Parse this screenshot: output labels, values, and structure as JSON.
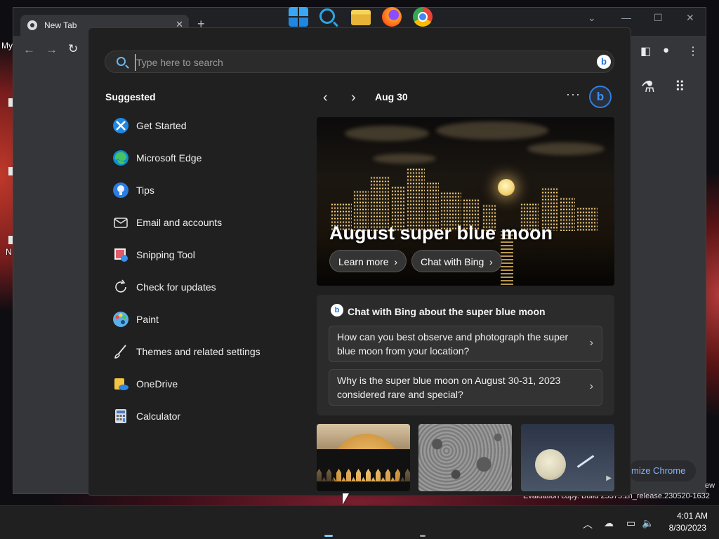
{
  "desktop": {
    "fragments": [
      "My",
      "N",
      "ew"
    ],
    "evaluation_text": "Evaluation copy. Build 25375.zn_release.230520-1632"
  },
  "chrome": {
    "tab_title": "New Tab",
    "customize_label": "mize Chrome"
  },
  "search": {
    "placeholder": "Type here to search",
    "bing_letter": "b"
  },
  "suggested": {
    "title": "Suggested",
    "items": [
      {
        "label": "Get Started",
        "icon": "get-started-icon"
      },
      {
        "label": "Microsoft Edge",
        "icon": "edge-icon"
      },
      {
        "label": "Tips",
        "icon": "tips-icon"
      },
      {
        "label": "Email and accounts",
        "icon": "mail-icon"
      },
      {
        "label": "Snipping Tool",
        "icon": "snipping-tool-icon"
      },
      {
        "label": "Check for updates",
        "icon": "refresh-icon"
      },
      {
        "label": "Paint",
        "icon": "paint-icon"
      },
      {
        "label": "Themes and related settings",
        "icon": "brush-icon"
      },
      {
        "label": "OneDrive",
        "icon": "onedrive-icon"
      },
      {
        "label": "Calculator",
        "icon": "calculator-icon"
      }
    ]
  },
  "highlights": {
    "date": "Aug 30",
    "hero_title": "August super blue moon",
    "learn_more": "Learn more",
    "chat_with_bing": "Chat with Bing",
    "chat_card_title": "Chat with Bing about the super blue moon",
    "prompts": [
      "How can you best observe and photograph the super blue moon from your location?",
      "Why is the super blue moon on August 30-31, 2023 considered rare and special?"
    ]
  },
  "taskbar": {
    "time": "4:01 AM",
    "date": "8/30/2023"
  },
  "colors": {
    "accent": "#2f7fe0",
    "flyout_bg": "#202020",
    "card_bg": "#2b2b2b"
  }
}
